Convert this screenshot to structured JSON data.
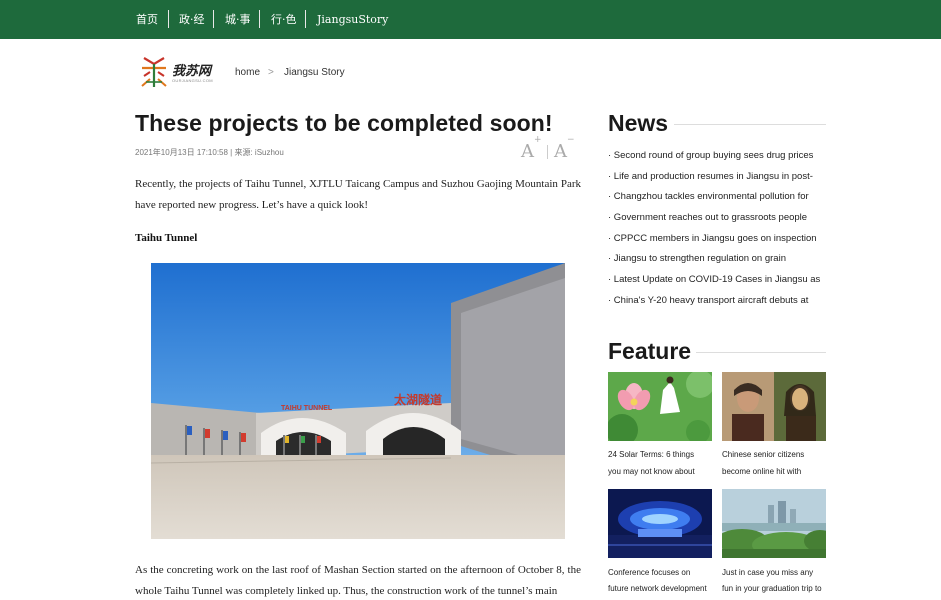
{
  "nav": {
    "items": [
      "首页",
      "政·经",
      "城·事",
      "行·色",
      "JiangsuStory"
    ]
  },
  "logo": {
    "text": "我苏网",
    "sub": "OURJIANGSU.COM"
  },
  "breadcrumb": {
    "home": "home",
    "sep": ">",
    "current": "Jiangsu Story"
  },
  "article": {
    "title": "These projects to be completed soon!",
    "meta": "2021年10月13日 17:10:58 | 来源:  iSuzhou",
    "font_up": "A",
    "font_up_sup": "+",
    "font_down": "A",
    "font_down_sup": "−",
    "intro": "Recently, the projects of Taihu Tunnel, XJTLU Taicang Campus and Suzhou Gaojing Mountain Park have reported new progress. Let’s have a quick look!",
    "subhead": "Taihu Tunnel",
    "photo_sign_en": "TAIHU TUNNEL",
    "photo_sign_cn": "太湖隧道",
    "body": "As the concreting work on the last roof of Mashan Section started on the afternoon of October 8, the whole Taihu Tunnel was completely linked up. Thus, the construction work of the tunnel’s main"
  },
  "news": {
    "title": "News",
    "items": [
      "· Second round of group buying sees drug prices",
      "· Life and production resumes in Jiangsu in post-",
      "· Changzhou tackles environmental pollution for",
      "· Government reaches out to grassroots people",
      "· CPPCC members in Jiangsu goes on inspection",
      "· Jiangsu to strengthen regulation on grain",
      "· Latest Update on COVID-19 Cases in Jiangsu as",
      "· China's Y-20 heavy transport aircraft debuts at"
    ]
  },
  "feature": {
    "title": "Feature",
    "items": [
      {
        "line1": "24 Solar Terms: 6 things",
        "line2": "you may not know about"
      },
      {
        "line1": "Chinese senior citizens",
        "line2": "become online hit with"
      },
      {
        "line1": "Conference focuses on",
        "line2": "future network development"
      },
      {
        "line1": "Just in case you miss any",
        "line2": "fun in your graduation trip to"
      }
    ]
  },
  "colors": {
    "nav_bg": "#1e6a3c",
    "title_text": "#1a1a1a",
    "meta_text": "#777777"
  }
}
